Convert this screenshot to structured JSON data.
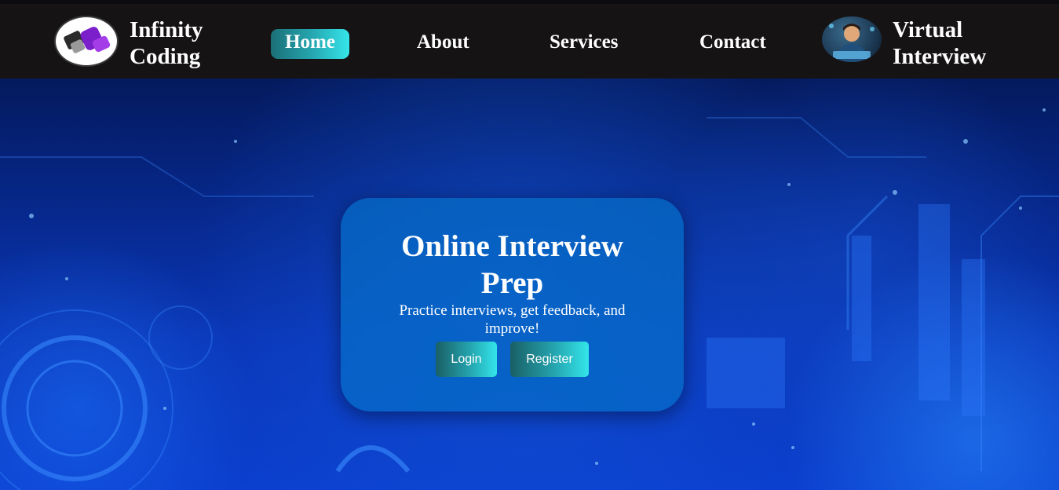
{
  "header": {
    "brand": [
      "Infinity",
      "Coding"
    ],
    "logo_icon": "infinity-coding-logo-icon",
    "nav": [
      {
        "label": "Home",
        "active": true
      },
      {
        "label": "About",
        "active": false
      },
      {
        "label": "Services",
        "active": false
      },
      {
        "label": "Contact",
        "active": false
      }
    ],
    "avatar_icon": "virtual-interview-avatar-icon",
    "right_brand": [
      "Virtual",
      "Interview"
    ]
  },
  "hero": {
    "title": [
      "Online Interview",
      "Prep"
    ],
    "subtitle": "Practice interviews, get feedback, and improve!",
    "login_label": "Login",
    "register_label": "Register"
  },
  "colors": {
    "navbar_bg": "#161315",
    "accent_gradient_start": "#1b6f76",
    "accent_gradient_end": "#35e6ea",
    "card_bg": "#066ec8",
    "hero_bg": "#0a36b8",
    "text": "#ffffff"
  }
}
